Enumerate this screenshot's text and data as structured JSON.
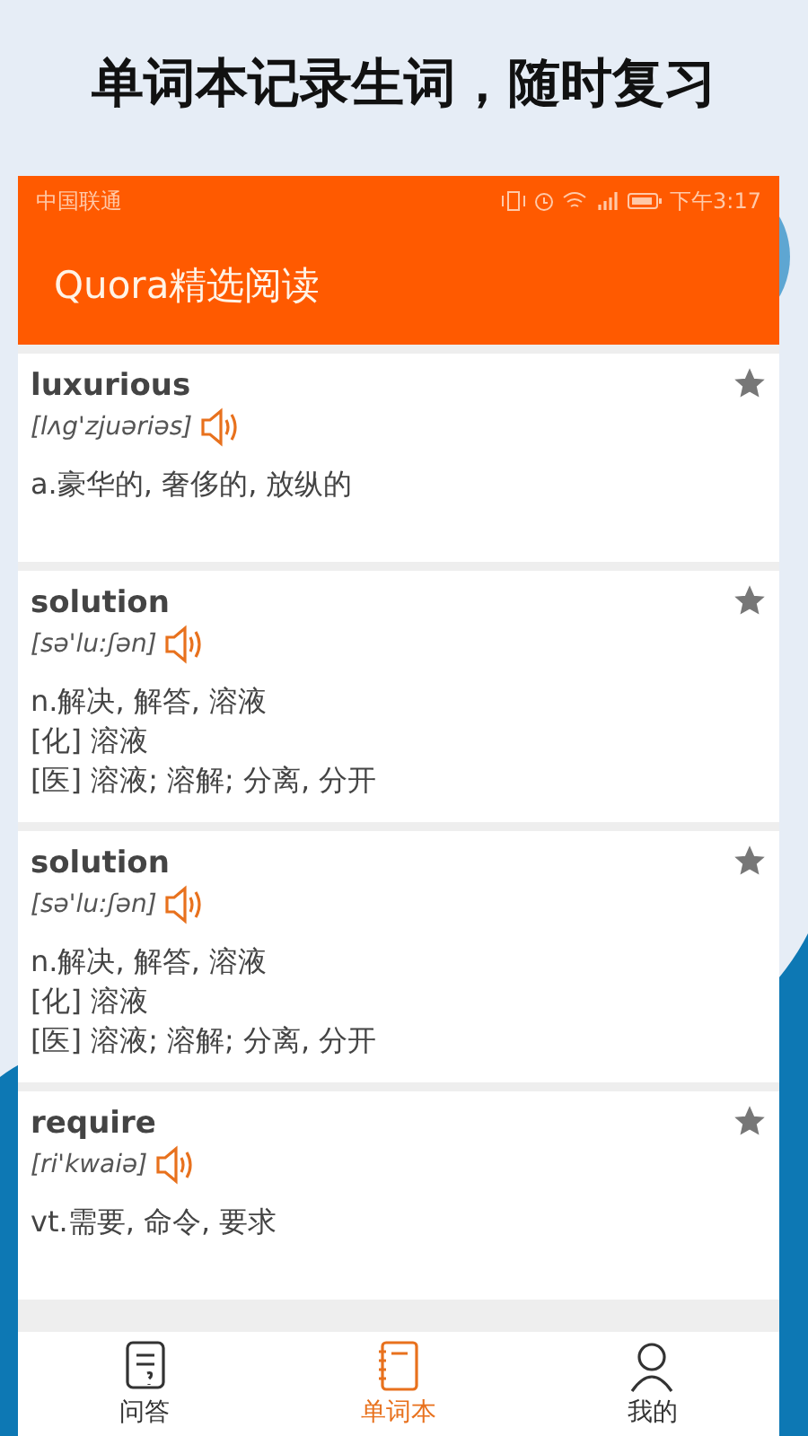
{
  "headline": "单词本记录生词，随时复习",
  "status_bar": {
    "carrier": "中国联通",
    "time": "下午3:17"
  },
  "app_bar": {
    "title": "Quora精选阅读"
  },
  "words": [
    {
      "word": "luxurious",
      "phonetic": "[lʌg'zjuəriəs]",
      "starred": true,
      "definitions": [
        "a.豪华的, 奢侈的, 放纵的"
      ]
    },
    {
      "word": "solution",
      "phonetic": "[sə'lu:ʃən]",
      "starred": true,
      "definitions": [
        "n.解决, 解答, 溶液",
        "[化] 溶液",
        "[医] 溶液; 溶解; 分离, 分开"
      ]
    },
    {
      "word": "solution",
      "phonetic": "[sə'lu:ʃən]",
      "starred": true,
      "definitions": [
        "n.解决, 解答, 溶液",
        "[化] 溶液",
        "[医] 溶液; 溶解; 分离, 分开"
      ]
    },
    {
      "word": "require",
      "phonetic": "[ri'kwaiə]",
      "starred": true,
      "definitions": [
        "vt.需要, 命令, 要求"
      ]
    }
  ],
  "tabs": [
    {
      "kind": "qa",
      "label": "问答",
      "selected": false
    },
    {
      "kind": "notebook",
      "label": "单词本",
      "selected": true
    },
    {
      "kind": "me",
      "label": "我的",
      "selected": false
    }
  ]
}
